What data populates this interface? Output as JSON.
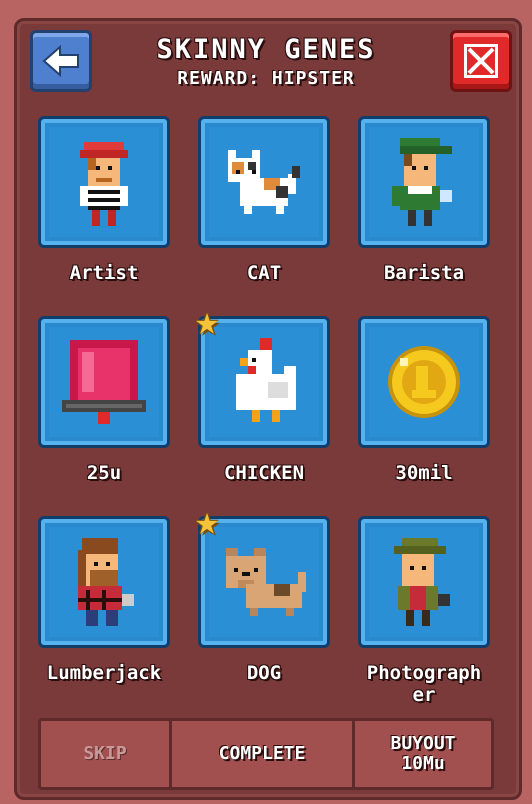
{
  "header": {
    "title": "SKINNY GENES",
    "subtitle": "REWARD: HIPSTER",
    "back_icon": "arrow-left-icon",
    "close_icon": "close-x-icon"
  },
  "items": [
    {
      "label": "Artist",
      "icon": "artist-character-icon",
      "starred": false
    },
    {
      "label": "CAT",
      "icon": "cat-icon",
      "starred": false
    },
    {
      "label": "Barista",
      "icon": "barista-character-icon",
      "starred": false
    },
    {
      "label": "25u",
      "icon": "red-cube-icon",
      "starred": false
    },
    {
      "label": "CHICKEN",
      "icon": "chicken-icon",
      "starred": true
    },
    {
      "label": "30mil",
      "icon": "gold-coin-icon",
      "starred": false
    },
    {
      "label": "Lumberjack",
      "icon": "lumberjack-character-icon",
      "starred": false
    },
    {
      "label": "DOG",
      "icon": "dog-icon",
      "starred": true
    },
    {
      "label": "Photograph\ner",
      "icon": "photographer-character-icon",
      "starred": false
    }
  ],
  "actions": {
    "skip": "SKIP",
    "complete": "COMPLETE",
    "buyout_line1": "BUYOUT",
    "buyout_line2": "10Mu"
  },
  "colors": {
    "tile": "#2b8fd6",
    "background": "#7b3a3a",
    "star": "#f6c33a"
  }
}
